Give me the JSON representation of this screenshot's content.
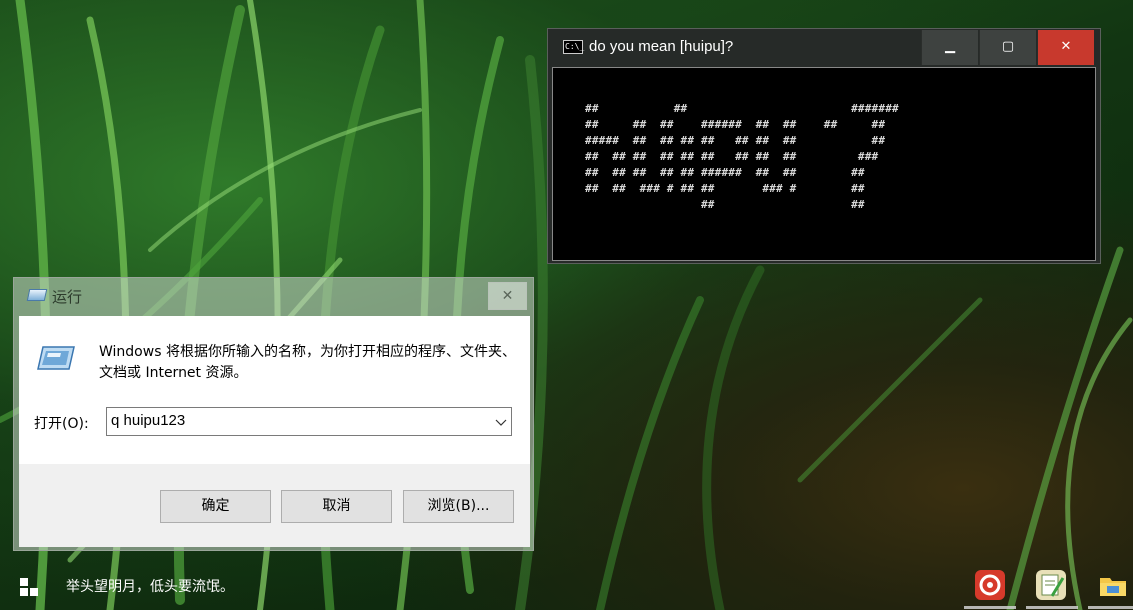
{
  "console": {
    "title": "do you mean [huipu]?",
    "icon_text": "C:\\_",
    "minimize_glyph": "▁",
    "maximize_glyph": "▢",
    "close_glyph": "✕",
    "ascii_art": "##           ##                        #######\n##     ##  ##    ######  ##  ##    ##     ##\n#####  ##  ## ## ##   ## ##  ##           ##\n##  ## ##  ## ## ##   ## ##  ##         ###\n##  ## ##  ## ## ######  ##  ##        ##\n##  ##  ### # ## ##       ### #        ##\n                 ##                    ##"
  },
  "run_dialog": {
    "title": "运行",
    "close_glyph": "✕",
    "description": "Windows 将根据你所输入的名称，为你打开相应的程序、文件夹、文档或 Internet 资源。",
    "open_label": "打开(O):",
    "input_value": "q huipu123",
    "buttons": {
      "ok": "确定",
      "cancel": "取消",
      "browse": "浏览(B)..."
    }
  },
  "desktop": {
    "caption": "举头望明月，低头要流氓。",
    "accent_color": "#c8392d"
  }
}
